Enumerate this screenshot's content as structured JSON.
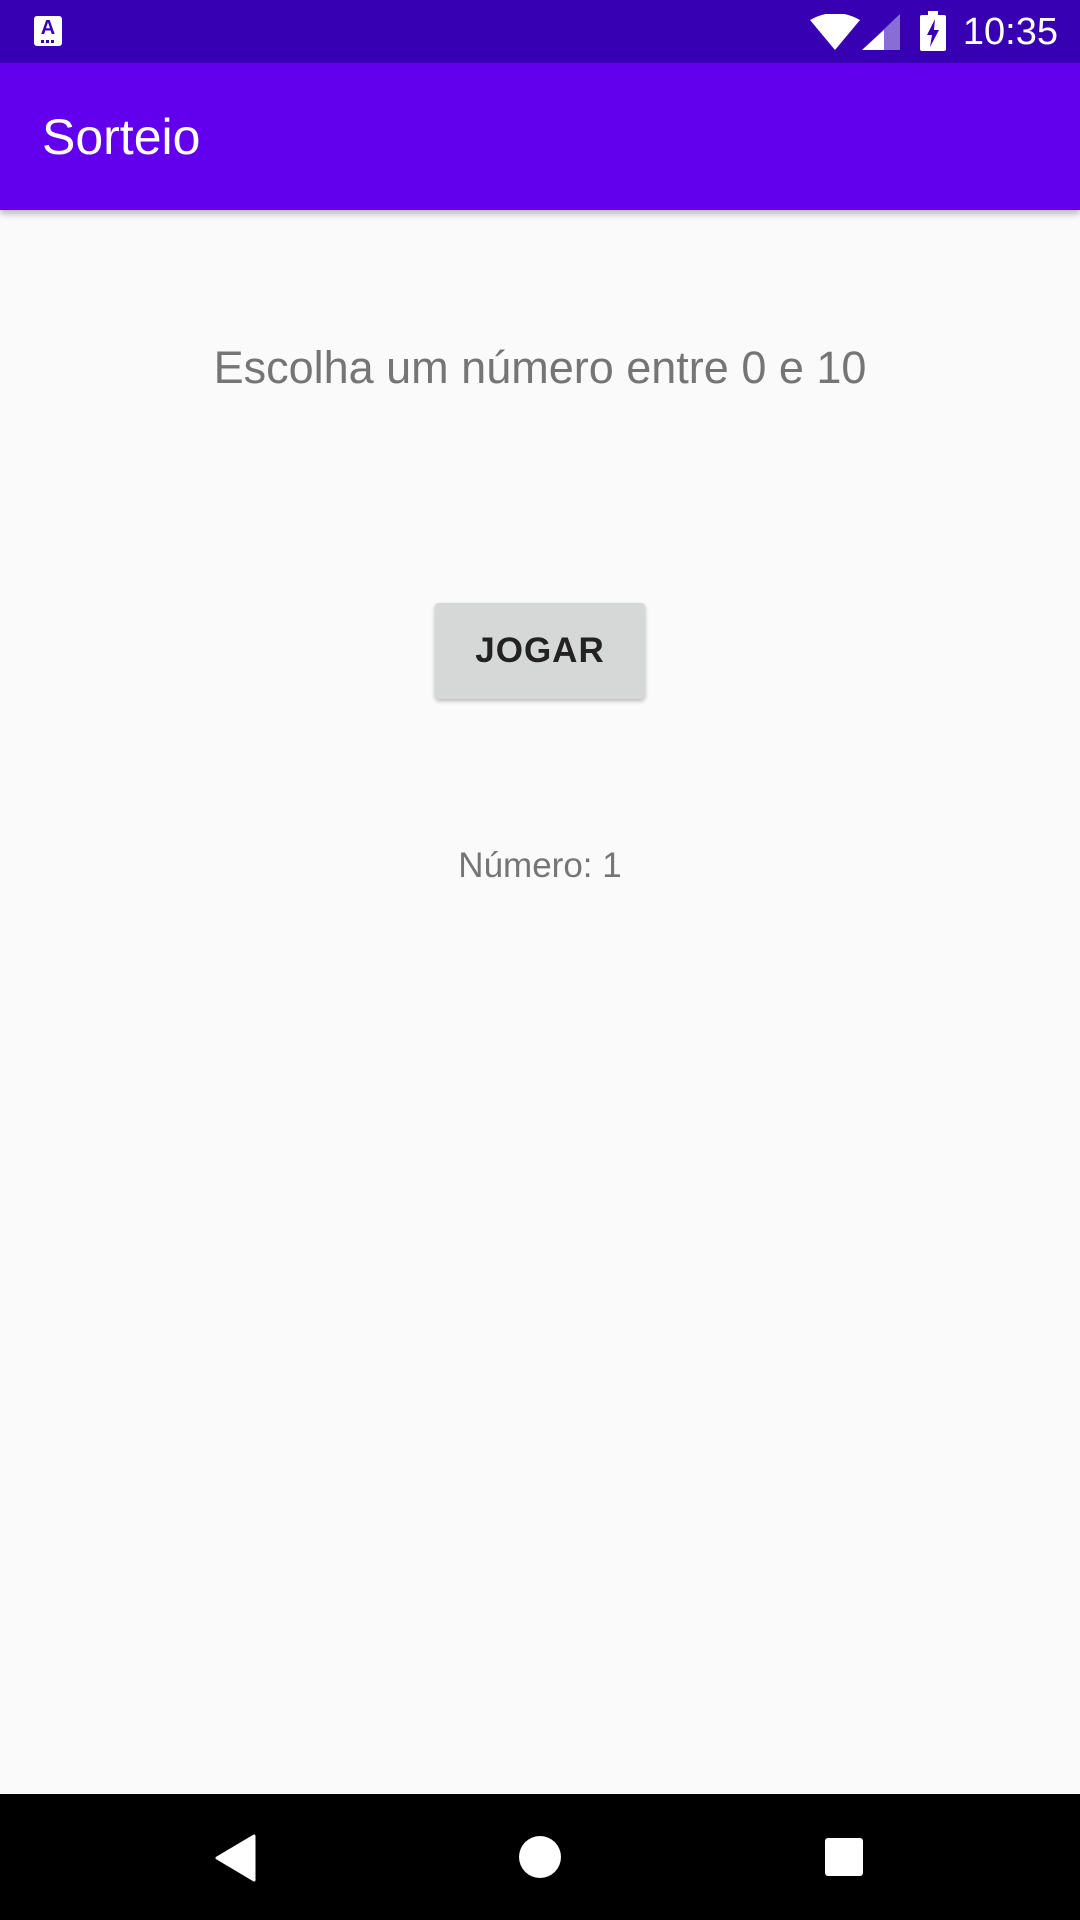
{
  "status_bar": {
    "time": "10:35",
    "left_icon": "accessibility-notification-icon",
    "icons": [
      "wifi-icon",
      "signal-icon",
      "battery-charging-icon"
    ]
  },
  "app_bar": {
    "title": "Sorteio"
  },
  "main": {
    "prompt": "Escolha um número entre 0 e 10",
    "play_button_label": "JOGAR",
    "result": "Número: 1"
  },
  "nav_bar": {
    "icons": [
      "back-icon",
      "home-icon",
      "recents-icon"
    ]
  },
  "colors": {
    "status_bar": "#3700b3",
    "app_bar": "#6200ee",
    "background": "#fafafa",
    "button": "#d6d7d7",
    "text_secondary": "#757575"
  }
}
